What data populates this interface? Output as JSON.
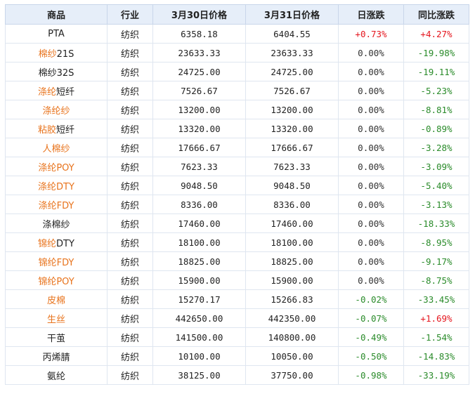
{
  "headers": [
    "商品",
    "行业",
    "3月30日价格",
    "3月31日价格",
    "日涨跌",
    "同比涨跌"
  ],
  "colors": {
    "link": "#e8731c",
    "up": "#e5161e",
    "down": "#2a8b2a",
    "header_bg": "#e6eef9"
  },
  "rows": [
    {
      "name": [
        {
          "t": "PTA",
          "link": false
        }
      ],
      "industry": "纺织",
      "p1": "6358.18",
      "p2": "6404.55",
      "day": "+0.73%",
      "day_dir": "up",
      "yoy": "+4.27%",
      "yoy_dir": "up"
    },
    {
      "name": [
        {
          "t": "棉纱",
          "link": true
        },
        {
          "t": "21S",
          "link": false
        }
      ],
      "industry": "纺织",
      "p1": "23633.33",
      "p2": "23633.33",
      "day": "0.00%",
      "day_dir": "flat",
      "yoy": "-19.98%",
      "yoy_dir": "down"
    },
    {
      "name": [
        {
          "t": "棉纱32S",
          "link": false
        }
      ],
      "industry": "纺织",
      "p1": "24725.00",
      "p2": "24725.00",
      "day": "0.00%",
      "day_dir": "flat",
      "yoy": "-19.11%",
      "yoy_dir": "down"
    },
    {
      "name": [
        {
          "t": "涤纶",
          "link": true
        },
        {
          "t": "短纤",
          "link": false
        }
      ],
      "industry": "纺织",
      "p1": "7526.67",
      "p2": "7526.67",
      "day": "0.00%",
      "day_dir": "flat",
      "yoy": "-5.23%",
      "yoy_dir": "down"
    },
    {
      "name": [
        {
          "t": "涤纶纱",
          "link": true
        }
      ],
      "industry": "纺织",
      "p1": "13200.00",
      "p2": "13200.00",
      "day": "0.00%",
      "day_dir": "flat",
      "yoy": "-8.81%",
      "yoy_dir": "down"
    },
    {
      "name": [
        {
          "t": "粘胶",
          "link": true
        },
        {
          "t": "短纤",
          "link": false
        }
      ],
      "industry": "纺织",
      "p1": "13320.00",
      "p2": "13320.00",
      "day": "0.00%",
      "day_dir": "flat",
      "yoy": "-0.89%",
      "yoy_dir": "down"
    },
    {
      "name": [
        {
          "t": "人棉纱",
          "link": true
        }
      ],
      "industry": "纺织",
      "p1": "17666.67",
      "p2": "17666.67",
      "day": "0.00%",
      "day_dir": "flat",
      "yoy": "-3.28%",
      "yoy_dir": "down"
    },
    {
      "name": [
        {
          "t": "涤纶POY",
          "link": true
        }
      ],
      "industry": "纺织",
      "p1": "7623.33",
      "p2": "7623.33",
      "day": "0.00%",
      "day_dir": "flat",
      "yoy": "-3.09%",
      "yoy_dir": "down"
    },
    {
      "name": [
        {
          "t": "涤纶DTY",
          "link": true
        }
      ],
      "industry": "纺织",
      "p1": "9048.50",
      "p2": "9048.50",
      "day": "0.00%",
      "day_dir": "flat",
      "yoy": "-5.40%",
      "yoy_dir": "down"
    },
    {
      "name": [
        {
          "t": "涤纶FDY",
          "link": true
        }
      ],
      "industry": "纺织",
      "p1": "8336.00",
      "p2": "8336.00",
      "day": "0.00%",
      "day_dir": "flat",
      "yoy": "-3.13%",
      "yoy_dir": "down"
    },
    {
      "name": [
        {
          "t": "涤棉纱",
          "link": false
        }
      ],
      "industry": "纺织",
      "p1": "17460.00",
      "p2": "17460.00",
      "day": "0.00%",
      "day_dir": "flat",
      "yoy": "-18.33%",
      "yoy_dir": "down"
    },
    {
      "name": [
        {
          "t": "锦纶",
          "link": true
        },
        {
          "t": "DTY",
          "link": false
        }
      ],
      "industry": "纺织",
      "p1": "18100.00",
      "p2": "18100.00",
      "day": "0.00%",
      "day_dir": "flat",
      "yoy": "-8.95%",
      "yoy_dir": "down"
    },
    {
      "name": [
        {
          "t": "锦纶FDY",
          "link": true
        }
      ],
      "industry": "纺织",
      "p1": "18825.00",
      "p2": "18825.00",
      "day": "0.00%",
      "day_dir": "flat",
      "yoy": "-9.17%",
      "yoy_dir": "down"
    },
    {
      "name": [
        {
          "t": "锦纶POY",
          "link": true
        }
      ],
      "industry": "纺织",
      "p1": "15900.00",
      "p2": "15900.00",
      "day": "0.00%",
      "day_dir": "flat",
      "yoy": "-8.75%",
      "yoy_dir": "down"
    },
    {
      "name": [
        {
          "t": "皮棉",
          "link": true
        }
      ],
      "industry": "纺织",
      "p1": "15270.17",
      "p2": "15266.83",
      "day": "-0.02%",
      "day_dir": "down",
      "yoy": "-33.45%",
      "yoy_dir": "down"
    },
    {
      "name": [
        {
          "t": "生丝",
          "link": true
        }
      ],
      "industry": "纺织",
      "p1": "442650.00",
      "p2": "442350.00",
      "day": "-0.07%",
      "day_dir": "down",
      "yoy": "+1.69%",
      "yoy_dir": "up"
    },
    {
      "name": [
        {
          "t": "干茧",
          "link": false
        }
      ],
      "industry": "纺织",
      "p1": "141500.00",
      "p2": "140800.00",
      "day": "-0.49%",
      "day_dir": "down",
      "yoy": "-1.54%",
      "yoy_dir": "down"
    },
    {
      "name": [
        {
          "t": "丙烯腈",
          "link": false
        }
      ],
      "industry": "纺织",
      "p1": "10100.00",
      "p2": "10050.00",
      "day": "-0.50%",
      "day_dir": "down",
      "yoy": "-14.83%",
      "yoy_dir": "down"
    },
    {
      "name": [
        {
          "t": "氨纶",
          "link": false
        }
      ],
      "industry": "纺织",
      "p1": "38125.00",
      "p2": "37750.00",
      "day": "-0.98%",
      "day_dir": "down",
      "yoy": "-33.19%",
      "yoy_dir": "down"
    }
  ]
}
